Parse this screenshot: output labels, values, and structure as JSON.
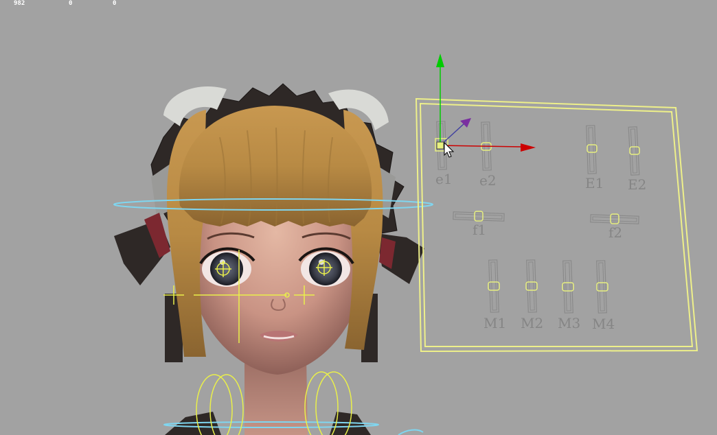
{
  "hud": {
    "stat_1": "982",
    "stat_2": "0",
    "stat_3": "0"
  },
  "panel": {
    "labels": {
      "e1": "e1",
      "e2": "e2",
      "E1": "E1",
      "E2": "E2",
      "f1": "f1",
      "f2": "f2",
      "M1": "M1",
      "M2": "M2",
      "M3": "M3",
      "M4": "M4"
    }
  },
  "gizmo": {
    "x_axis_color": "#cc0000",
    "y_axis_color": "#00cc00",
    "z_axis_color": "#7a2fa0"
  },
  "colors": {
    "viewport_bg": "#a2a2a2",
    "panel_outline": "#eef08a",
    "control_outline": "#e8f080",
    "locator": "#eaf04a",
    "ring": "#7fd6f0",
    "control_label": "#858585"
  }
}
